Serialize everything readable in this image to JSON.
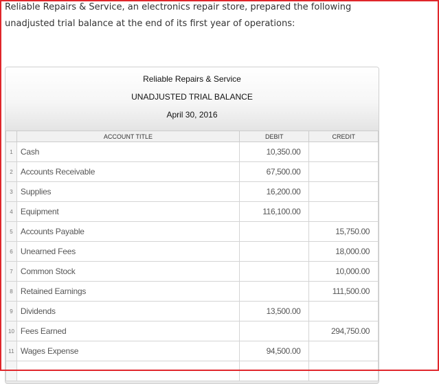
{
  "intro": {
    "line1": "Reliable Repairs & Service, an electronics repair store, prepared the following",
    "line2": "unadjusted trial balance at the end of its first year of operations:"
  },
  "statement": {
    "company": "Reliable Repairs & Service",
    "title": "UNADJUSTED TRIAL BALANCE",
    "date": "April 30, 2016"
  },
  "table": {
    "headers": {
      "account": "ACCOUNT TITLE",
      "debit": "DEBIT",
      "credit": "CREDIT"
    },
    "rows": [
      {
        "num": "1",
        "account": "Cash",
        "debit": "10,350.00",
        "credit": ""
      },
      {
        "num": "2",
        "account": "Accounts Receivable",
        "debit": "67,500.00",
        "credit": ""
      },
      {
        "num": "3",
        "account": "Supplies",
        "debit": "16,200.00",
        "credit": ""
      },
      {
        "num": "4",
        "account": "Equipment",
        "debit": "116,100.00",
        "credit": ""
      },
      {
        "num": "5",
        "account": "Accounts Payable",
        "debit": "",
        "credit": "15,750.00"
      },
      {
        "num": "6",
        "account": "Unearned Fees",
        "debit": "",
        "credit": "18,000.00"
      },
      {
        "num": "7",
        "account": "Common Stock",
        "debit": "",
        "credit": "10,000.00"
      },
      {
        "num": "8",
        "account": "Retained Earnings",
        "debit": "",
        "credit": "111,500.00"
      },
      {
        "num": "9",
        "account": "Dividends",
        "debit": "13,500.00",
        "credit": ""
      },
      {
        "num": "10",
        "account": "Fees Earned",
        "debit": "",
        "credit": "294,750.00"
      },
      {
        "num": "11",
        "account": "Wages Expense",
        "debit": "94,500.00",
        "credit": ""
      },
      {
        "num": "",
        "account": "",
        "debit": "",
        "credit": ""
      }
    ]
  },
  "colors": {
    "frame": "#e0262b",
    "text": "#333333"
  }
}
